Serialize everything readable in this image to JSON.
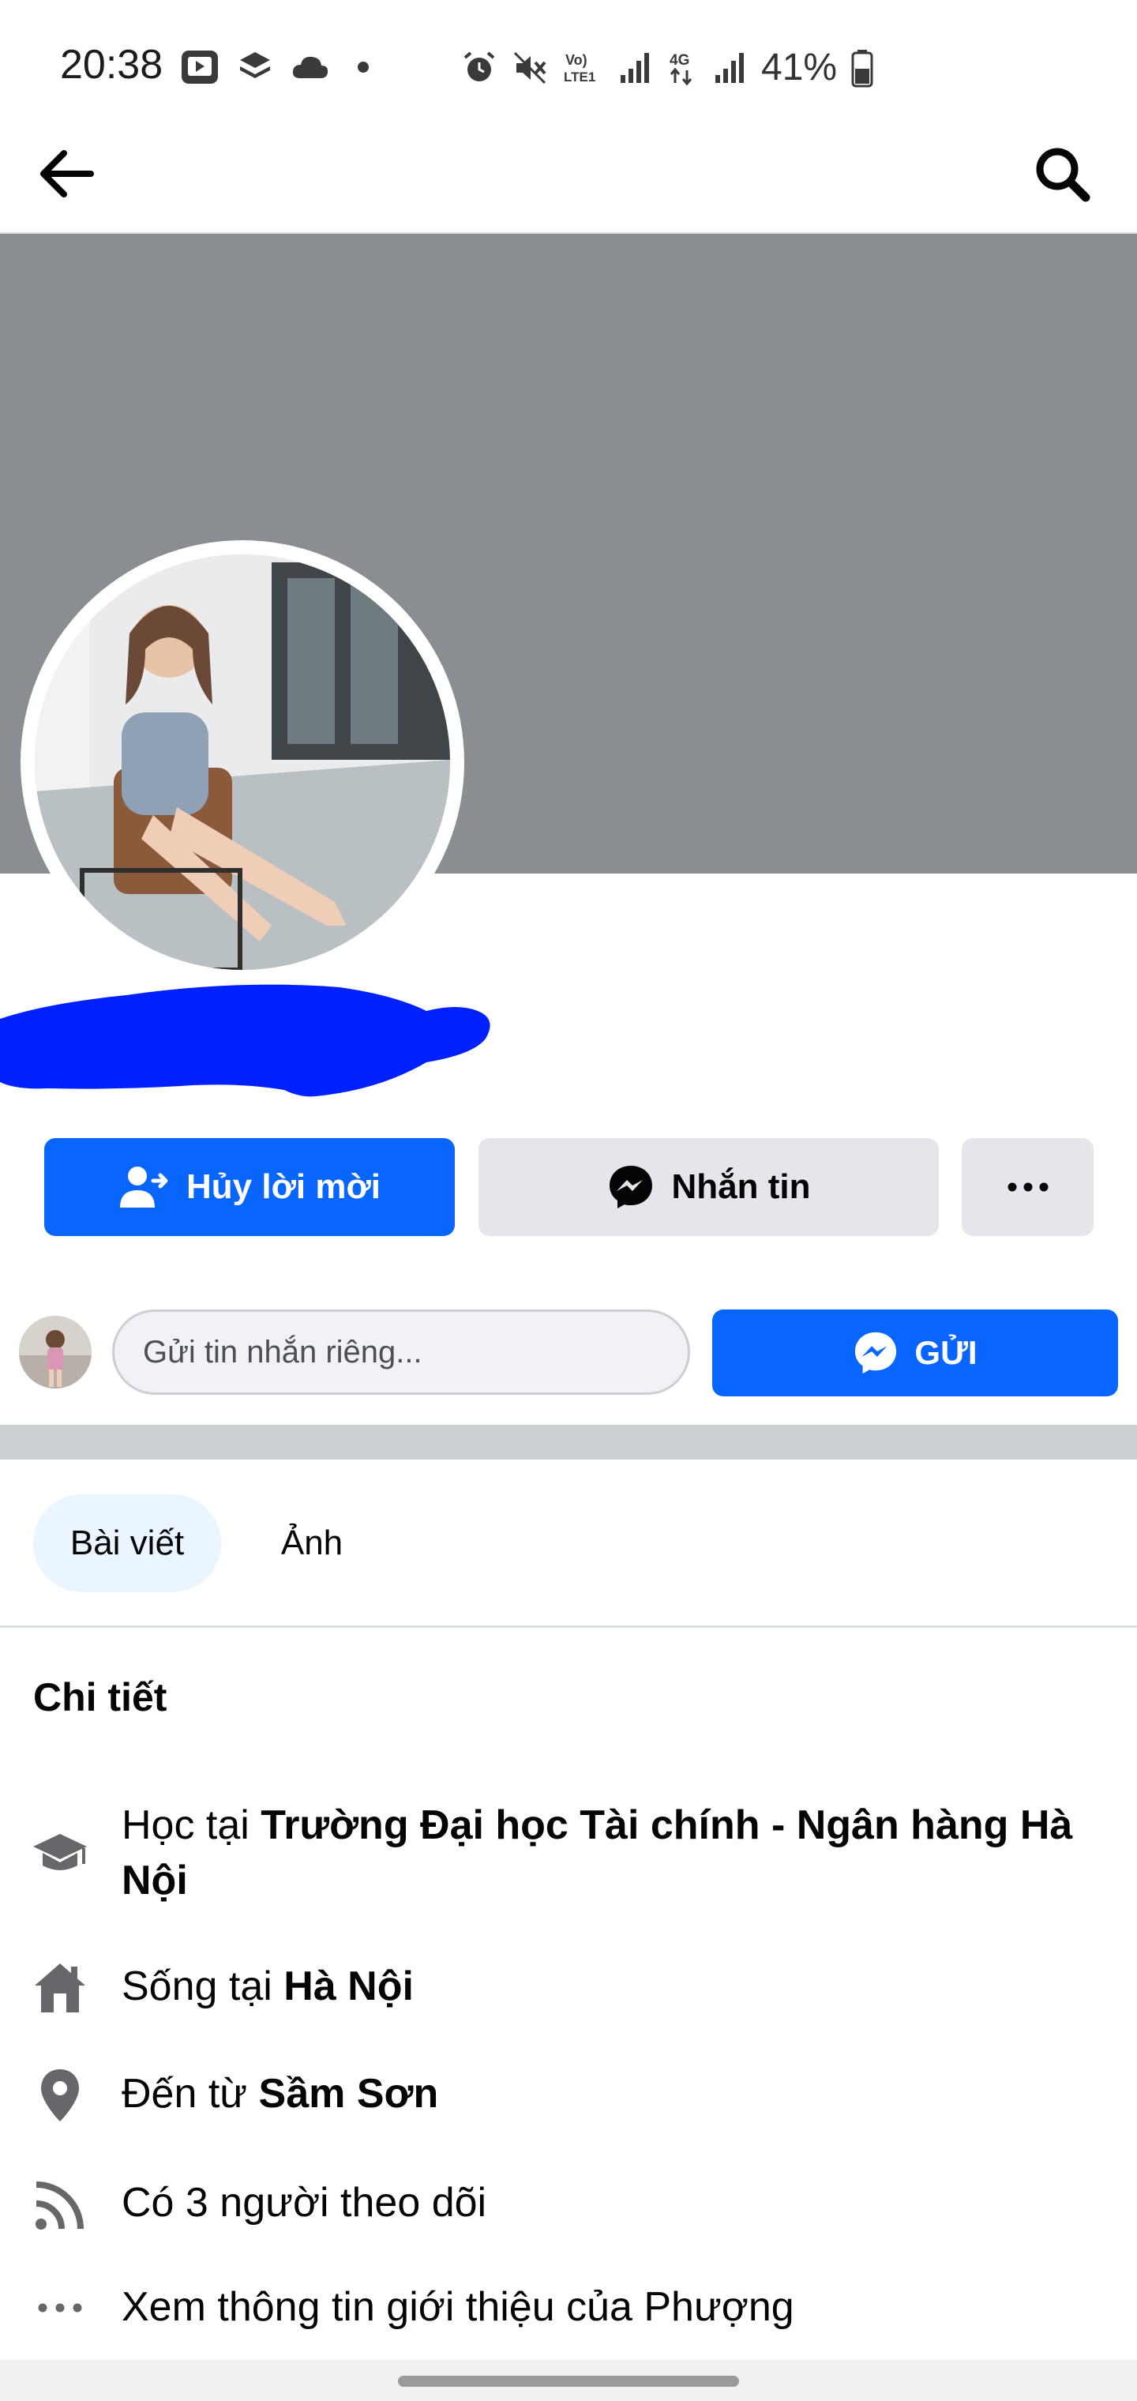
{
  "status_bar": {
    "time": "20:38",
    "battery": "41%",
    "icons_left": [
      "video-icon",
      "layers-icon",
      "cloud-icon",
      "dot-icon"
    ],
    "icons_right": [
      "alarm-icon",
      "mute-icon",
      "volte-icon",
      "signal-icon",
      "4g-icon",
      "signal-icon",
      "battery-icon"
    ]
  },
  "app_bar": {
    "back_icon": "arrow-left-icon",
    "search_icon": "search-icon"
  },
  "colors": {
    "brand_blue": "#0866ff",
    "button_gray": "#e4e6eb",
    "cover_gray": "#8a8d91",
    "redaction_blue": "#0021ff",
    "tab_selected_bg": "#ebf5ff"
  },
  "actions": {
    "cancel_request": "Hủy lời mời",
    "message": "Nhắn tin",
    "more_icon": "more-horizontal-icon"
  },
  "private_message": {
    "placeholder": "Gửi tin nhắn riêng...",
    "send_label": "GỬI"
  },
  "tabs": [
    {
      "label": "Bài viết",
      "selected": true
    },
    {
      "label": "Ảnh",
      "selected": false
    }
  ],
  "details": {
    "title": "Chi tiết",
    "items": [
      {
        "icon": "graduation-cap-icon",
        "prefix": "Học tại ",
        "bold": "Trường Đại học Tài chính - Ngân hàng Hà Nội",
        "suffix": ""
      },
      {
        "icon": "home-icon",
        "prefix": "Sống tại ",
        "bold": "Hà Nội",
        "suffix": ""
      },
      {
        "icon": "location-pin-icon",
        "prefix": "Đến từ ",
        "bold": "Sầm Sơn",
        "suffix": ""
      },
      {
        "icon": "rss-icon",
        "prefix": "Có 3 người theo dõi",
        "bold": "",
        "suffix": ""
      },
      {
        "icon": "more-horizontal-icon",
        "prefix": "Xem thông tin giới thiệu của Phượng",
        "bold": "",
        "suffix": ""
      }
    ]
  }
}
